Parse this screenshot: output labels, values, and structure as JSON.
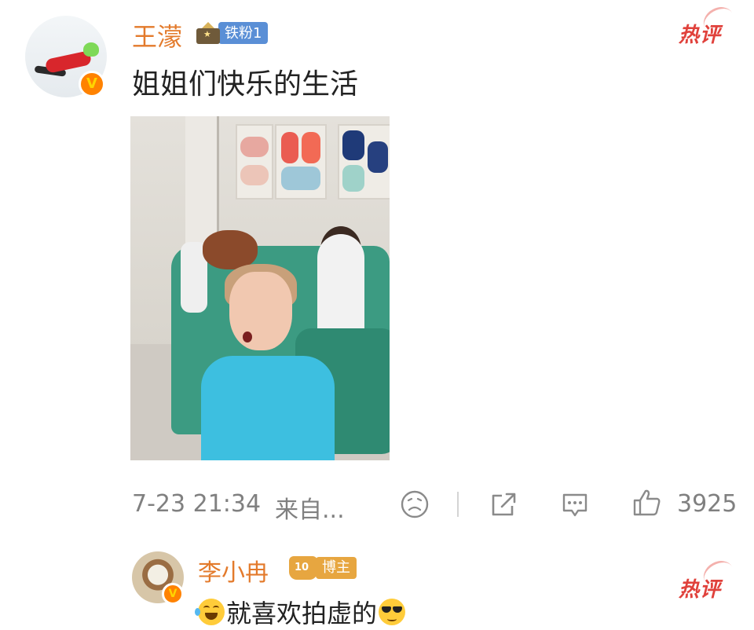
{
  "comment1": {
    "username": "王濛",
    "fan_badge": "铁粉1",
    "text": "姐姐们快乐的生活",
    "hot_label": "热评",
    "time": "7-23 21:34",
    "source": "来自...",
    "likes": "3925",
    "icons": [
      "verified-icon",
      "fan-crown-icon",
      "sad-face-icon",
      "share-icon",
      "comment-icon",
      "like-icon"
    ]
  },
  "comment2": {
    "username": "李小冉",
    "crown_level": "10",
    "badge": "博主",
    "hot_label": "热评",
    "text": "就喜欢拍虚的",
    "icons": [
      "laughing-crying-emoji",
      "sunglasses-emoji",
      "verified-icon"
    ]
  },
  "colors": {
    "username": "#e37a2b",
    "hot": "#e0413b",
    "verified": "#ff8200",
    "fan_pill": "#5a8fd6",
    "bozhu_pill": "#e7a640",
    "meta_text": "#808080"
  }
}
